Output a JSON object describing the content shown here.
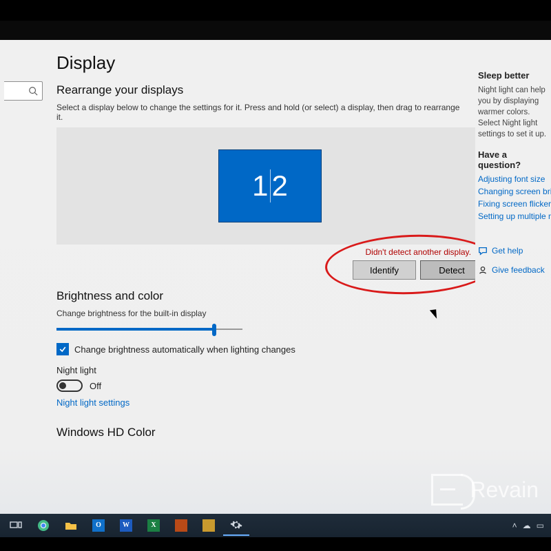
{
  "page": {
    "title": "Display",
    "rearrange_heading": "Rearrange your displays",
    "rearrange_subtext": "Select a display below to change the settings for it. Press and hold (or select) a display, then drag to rearrange it.",
    "monitor_label_1": "1",
    "monitor_label_2": "2",
    "detect_warning": "Didn't detect another display.",
    "identify_btn": "Identify",
    "detect_btn": "Detect",
    "brightness_heading": "Brightness and color",
    "brightness_slider_label": "Change brightness for the built-in display",
    "auto_brightness_label": "Change brightness automatically when lighting changes",
    "night_light_label": "Night light",
    "night_light_state": "Off",
    "night_light_link": "Night light settings",
    "hd_color_heading": "Windows HD Color"
  },
  "aside": {
    "sleep_heading": "Sleep better",
    "sleep_body": "Night light can help you by displaying warmer colors. Select Night light settings to set it up.",
    "question_heading": "Have a question?",
    "links": {
      "font": "Adjusting font size",
      "bright": "Changing screen brightness",
      "flicker": "Fixing screen flickering",
      "multi": "Setting up multiple monitors"
    },
    "get_help": "Get help",
    "give_feedback": "Give feedback"
  },
  "watermark": "Revain"
}
